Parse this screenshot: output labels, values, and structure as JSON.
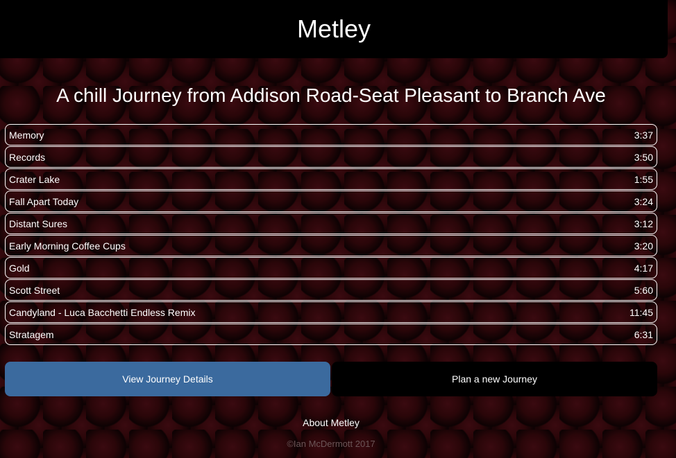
{
  "header": {
    "title": "Metley"
  },
  "journey": {
    "title": "A chill Journey from Addison Road-Seat Pleasant to Branch Ave"
  },
  "tracks": [
    {
      "name": "Memory",
      "duration": "3:37"
    },
    {
      "name": "Records",
      "duration": "3:50"
    },
    {
      "name": "Crater Lake",
      "duration": "1:55"
    },
    {
      "name": "Fall Apart Today",
      "duration": "3:24"
    },
    {
      "name": "Distant Sures",
      "duration": "3:12"
    },
    {
      "name": "Early Morning Coffee Cups",
      "duration": "3:20"
    },
    {
      "name": "Gold",
      "duration": "4:17"
    },
    {
      "name": "Scott Street",
      "duration": "5:60"
    },
    {
      "name": "Candyland - Luca Bacchetti Endless Remix",
      "duration": "11:45"
    },
    {
      "name": "Stratagem",
      "duration": "6:31"
    }
  ],
  "actions": {
    "view_details_label": "View Journey Details",
    "plan_new_label": "Plan a new Journey"
  },
  "footer": {
    "about_label": "About Metley",
    "copyright": "©Ian McDermott 2017"
  },
  "colors": {
    "primary_button": "#3b6a9e",
    "secondary_button": "#000000",
    "background": "#1a0406"
  }
}
